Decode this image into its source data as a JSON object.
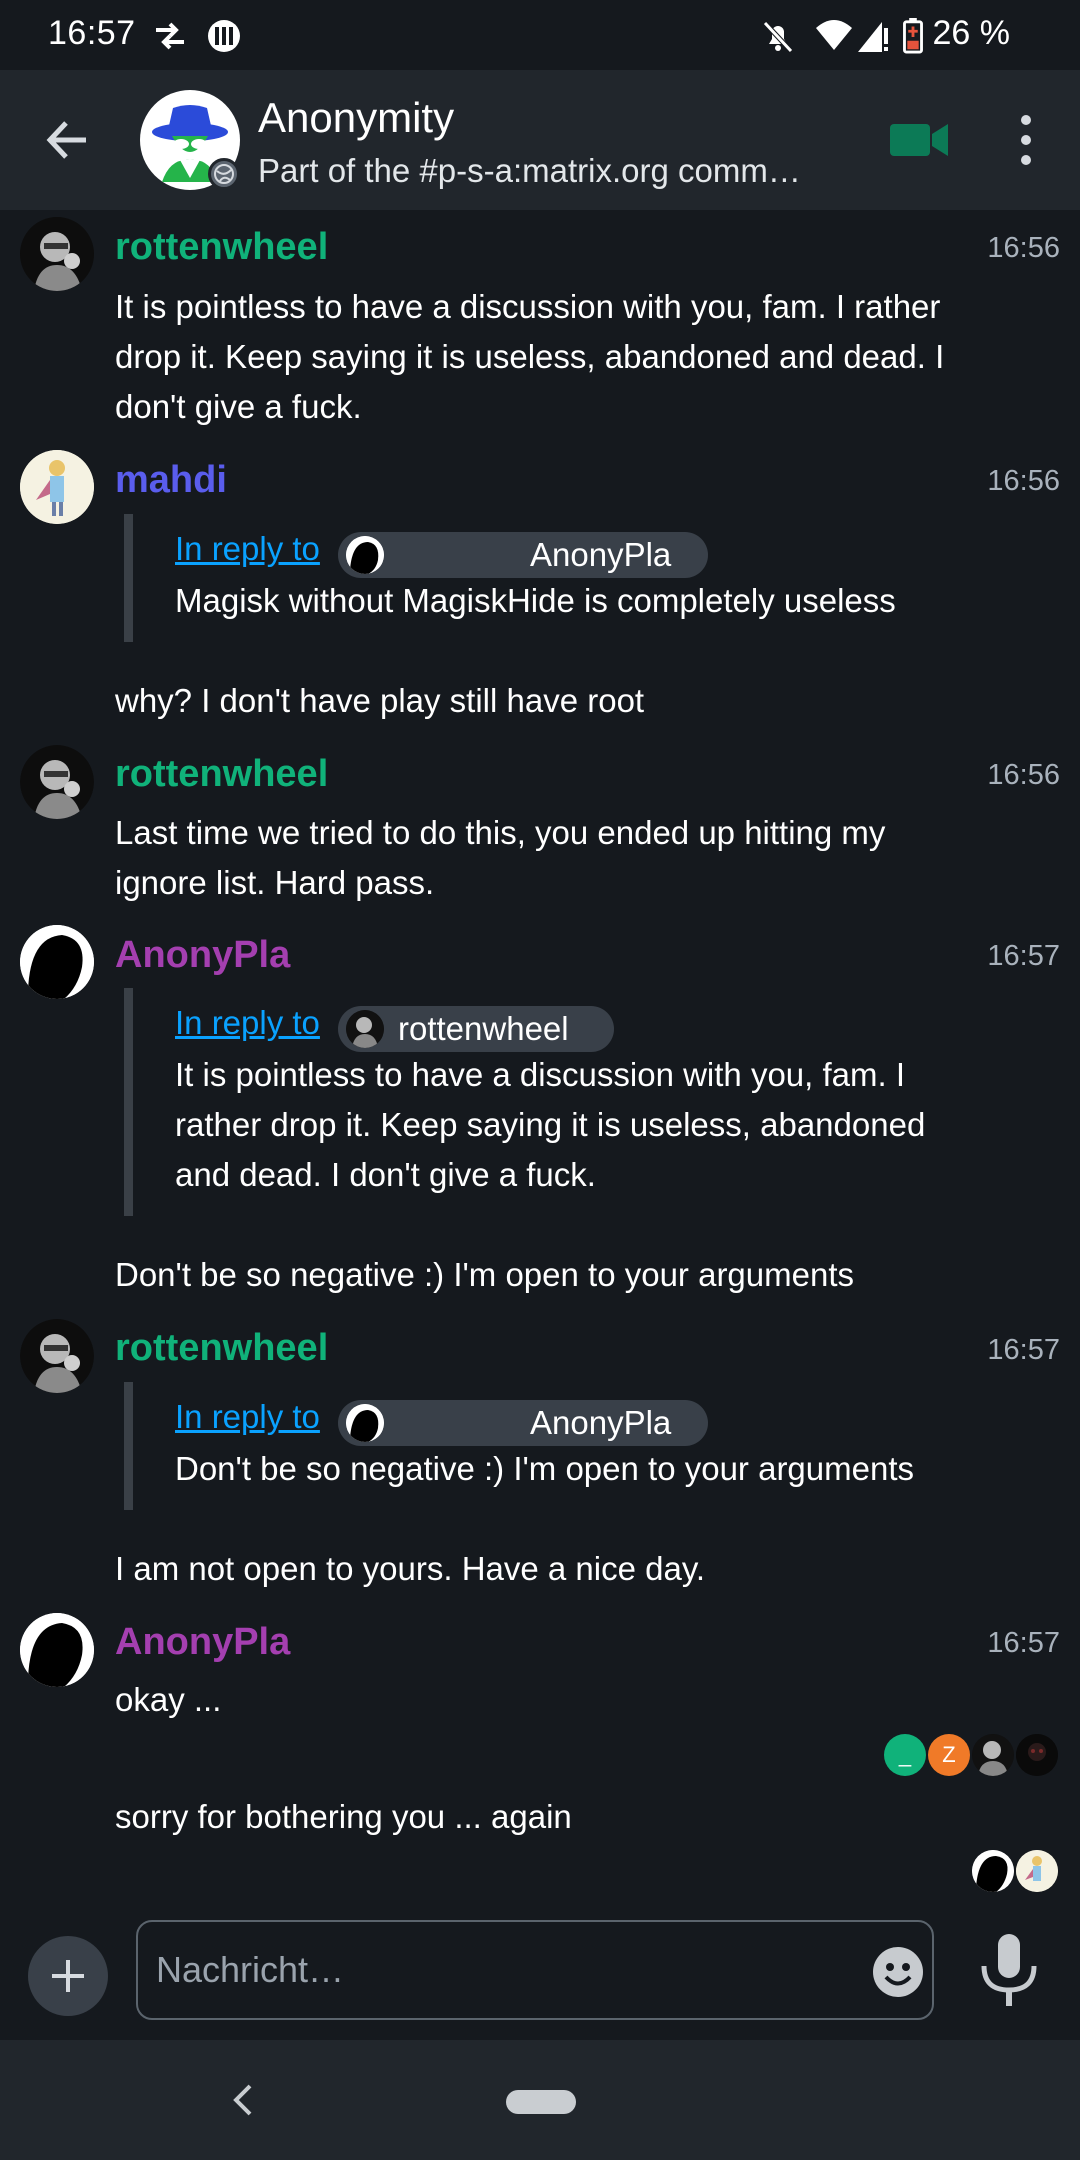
{
  "status_bar": {
    "time": "16:57",
    "battery": "26 %"
  },
  "room": {
    "name": "Anonymity",
    "topic": "Part of the #p-s-a:matrix.org comm…"
  },
  "colors": {
    "rottenwheel": "#10b27a",
    "mahdi": "#5a5ded",
    "anonypla": "#a43fb0",
    "link": "#0aa2ff",
    "background": "#15191e"
  },
  "events": {
    "e1": {
      "sender": "rottenwheel",
      "time": "16:56",
      "body": "It is pointless to have a discussion with you, fam. I rather drop it. Keep saying it is useless, abandoned and dead. I don't give a fuck."
    },
    "e2": {
      "sender": "mahdi",
      "time": "16:56",
      "reply_label": "In reply to",
      "reply_user": "AnonyPla",
      "quote": "Magisk without MagiskHide is completely useless",
      "body": "why? I don't have play still have root"
    },
    "e3": {
      "sender": "rottenwheel",
      "time": "16:56",
      "body": "Last time we tried to do this, you ended up hitting my ignore list. Hard pass."
    },
    "e4": {
      "sender": "AnonyPla",
      "time": "16:57",
      "reply_label": "In reply to",
      "reply_user": "rottenwheel",
      "quote": "It is pointless to have a discussion with you, fam. I rather drop it. Keep saying it is useless, abandoned and dead. I don't give a fuck.",
      "body": "Don't be so negative :) I'm open to your arguments"
    },
    "e5": {
      "sender": "rottenwheel",
      "time": "16:57",
      "reply_label": "In reply to",
      "reply_user": "AnonyPla",
      "quote": "Don't be so negative :) I'm open to your arguments",
      "body": "I am not open to yours. Have a nice day."
    },
    "e6": {
      "sender": "AnonyPla",
      "time": "16:57",
      "body": "okay ...",
      "body2": "sorry for bothering you ... again"
    }
  },
  "read_receipts": {
    "r1": "_",
    "r2": "Z"
  },
  "composer": {
    "placeholder": "Nachricht…"
  }
}
